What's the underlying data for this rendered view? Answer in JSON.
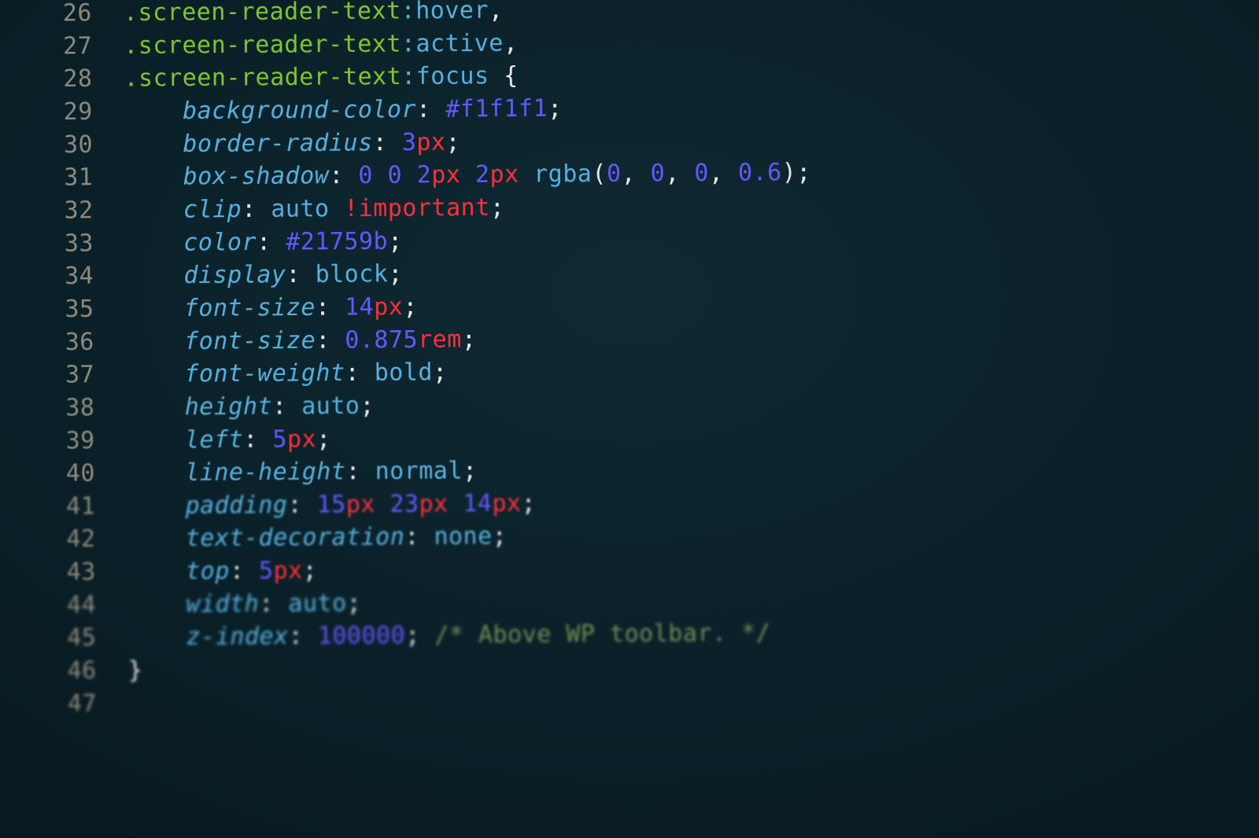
{
  "lines": {
    "l26": {
      "num": "26",
      "sel1": ".screen-reader-text",
      "pseudo1": ":hover",
      "comma": ","
    },
    "l27": {
      "num": "27",
      "sel1": ".screen-reader-text",
      "pseudo1": ":active",
      "comma": ","
    },
    "l28": {
      "num": "28",
      "sel1": ".screen-reader-text",
      "pseudo1": ":focus",
      "brace": " {"
    },
    "l29": {
      "num": "29",
      "prop": "background-color",
      "colon": ": ",
      "hex": "#f1f1f1",
      "semi": ";"
    },
    "l30": {
      "num": "30",
      "prop": "border-radius",
      "colon": ": ",
      "n1": "3",
      "u1": "px",
      "semi": ";"
    },
    "l31": {
      "num": "31",
      "prop": "box-shadow",
      "colon": ": ",
      "n1": "0",
      "sp1": " ",
      "n2": "0",
      "sp2": " ",
      "n3": "2",
      "u3": "px",
      "sp3": " ",
      "n4": "2",
      "u4": "px",
      "sp4": " ",
      "func": "rgba",
      "open": "(",
      "a1": "0",
      "c1": ", ",
      "a2": "0",
      "c2": ", ",
      "a3": "0",
      "c3": ", ",
      "a4": "0.6",
      "close": ")",
      "semi": ";"
    },
    "l32": {
      "num": "32",
      "prop": "clip",
      "colon": ": ",
      "val": "auto",
      "sp": " ",
      "kw": "!important",
      "semi": ";"
    },
    "l33": {
      "num": "33",
      "prop": "color",
      "colon": ": ",
      "hex": "#21759b",
      "semi": ";"
    },
    "l34": {
      "num": "34",
      "prop": "display",
      "colon": ": ",
      "val": "block",
      "semi": ";"
    },
    "l35": {
      "num": "35",
      "prop": "font-size",
      "colon": ": ",
      "n1": "14",
      "u1": "px",
      "semi": ";"
    },
    "l36": {
      "num": "36",
      "prop": "font-size",
      "colon": ": ",
      "n1": "0.875",
      "u1": "rem",
      "semi": ";"
    },
    "l37": {
      "num": "37",
      "prop": "font-weight",
      "colon": ": ",
      "val": "bold",
      "semi": ";"
    },
    "l38": {
      "num": "38",
      "prop": "height",
      "colon": ": ",
      "val": "auto",
      "semi": ";"
    },
    "l39": {
      "num": "39",
      "prop": "left",
      "colon": ": ",
      "n1": "5",
      "u1": "px",
      "semi": ";"
    },
    "l40": {
      "num": "40",
      "prop": "line-height",
      "colon": ": ",
      "val": "normal",
      "semi": ";"
    },
    "l41": {
      "num": "41",
      "prop": "padding",
      "colon": ": ",
      "n1": "15",
      "u1": "px",
      "sp1": " ",
      "n2": "23",
      "u2": "px",
      "sp2": " ",
      "n3": "14",
      "u3": "px",
      "semi": ";"
    },
    "l42": {
      "num": "42",
      "prop": "text-decoration",
      "colon": ": ",
      "val": "none",
      "semi": ";"
    },
    "l43": {
      "num": "43",
      "prop": "top",
      "colon": ": ",
      "n1": "5",
      "u1": "px",
      "semi": ";"
    },
    "l44": {
      "num": "44",
      "prop": "width",
      "colon": ": ",
      "val": "auto",
      "semi": ";"
    },
    "l45": {
      "num": "45",
      "prop": "z-index",
      "colon": ": ",
      "n1": "100000",
      "semi": ";",
      "sp": " ",
      "comment": "/* Above WP toolbar. */"
    },
    "l46": {
      "num": "46",
      "brace": "}"
    },
    "l47": {
      "num": "47"
    }
  }
}
